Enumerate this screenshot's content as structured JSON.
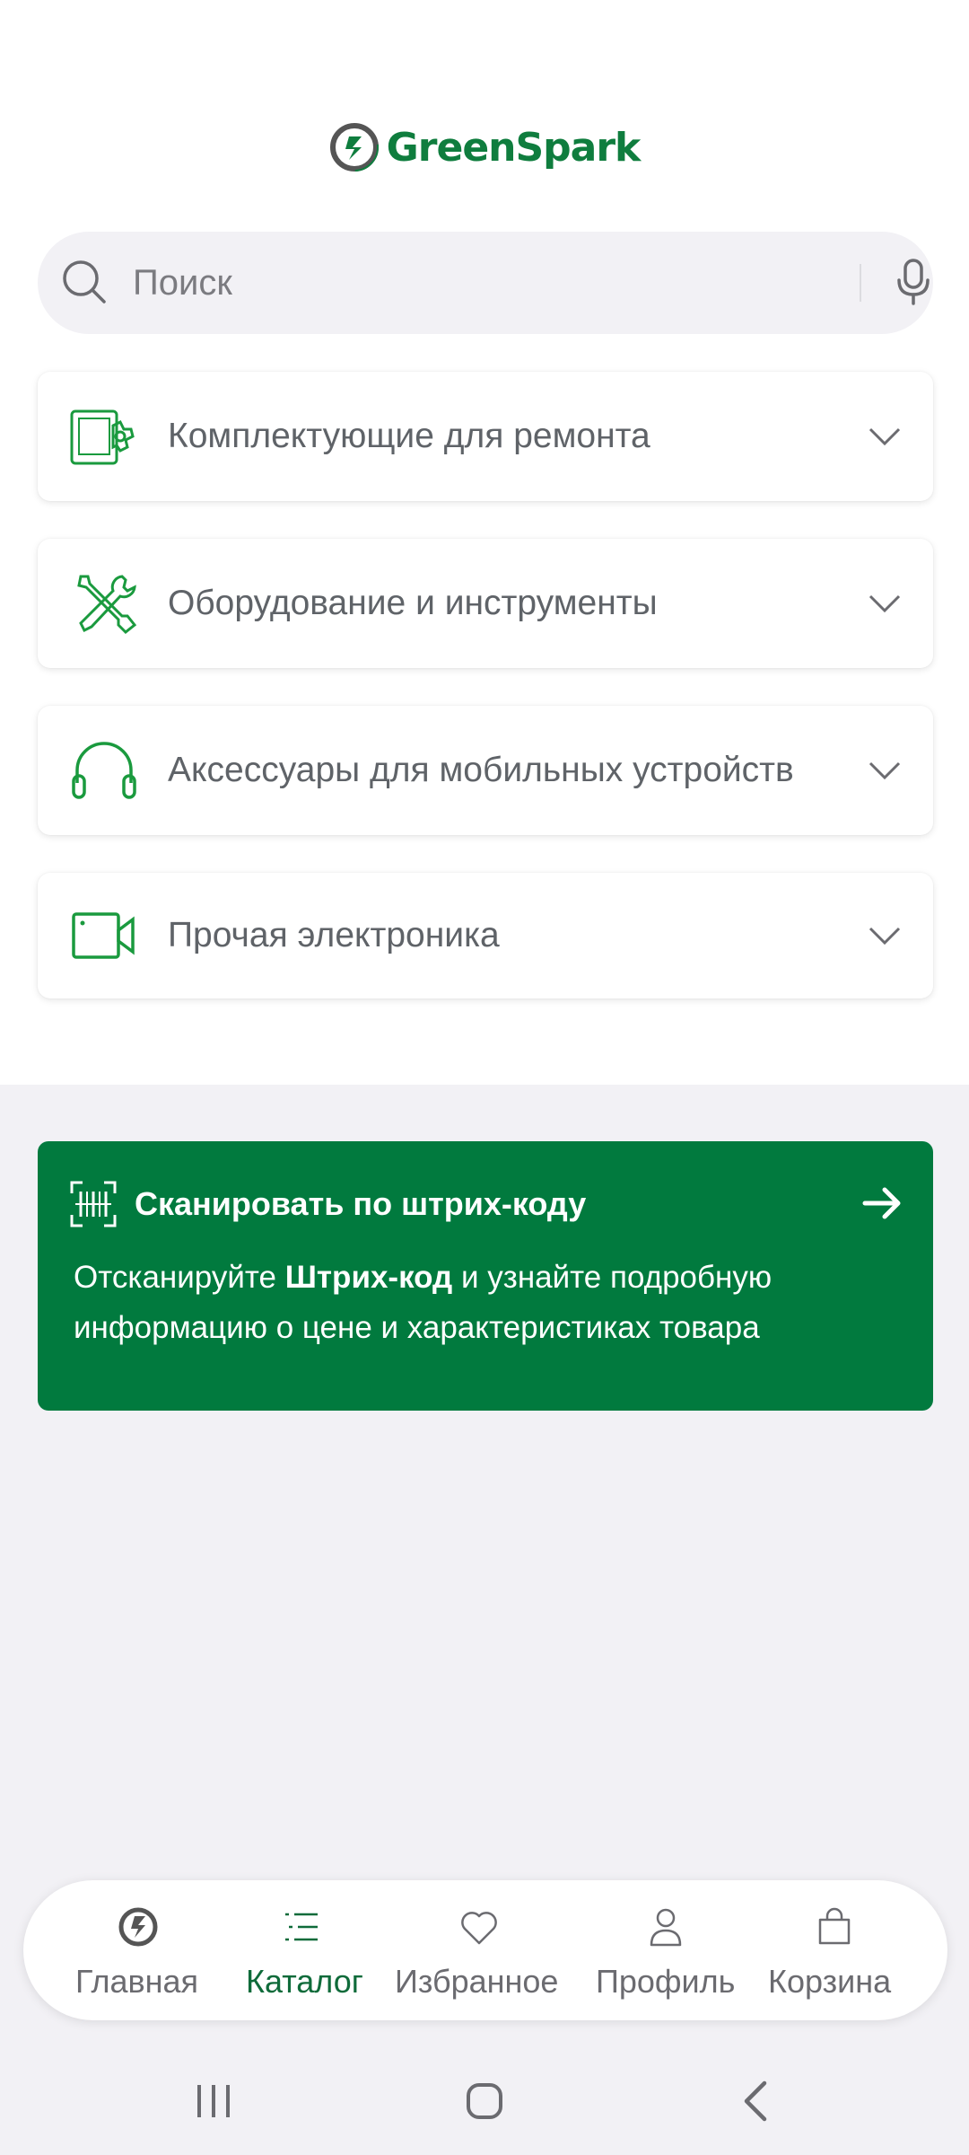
{
  "app": {
    "logo_text": "GreenSpark",
    "brand_color": "#0f7d3e",
    "accent_dark": "#017a3e"
  },
  "search": {
    "placeholder": "Поиск",
    "value": "",
    "icon": "search-icon",
    "mic_icon": "microphone-icon"
  },
  "categories": [
    {
      "label": "Комплектующие для ремонта",
      "icon": "phone-gear-icon"
    },
    {
      "label": "Оборудование и инструменты",
      "icon": "tools-icon"
    },
    {
      "label": "Аксессуары для мобильных устройств",
      "icon": "headphones-icon"
    },
    {
      "label": "Прочая электроника",
      "icon": "video-camera-icon"
    }
  ],
  "scan_banner": {
    "title": "Сканировать по штрих-коду",
    "desc_part1": "Отсканируйте ",
    "desc_bold": "Штрих-код",
    "desc_part2": " и узнайте подробную информацию о цене и характеристиках товара",
    "icon": "barcode-scan-icon",
    "arrow_icon": "arrow-right-icon"
  },
  "bottom_nav": {
    "items": [
      {
        "label": "Главная",
        "icon": "home-logo-icon",
        "active": false
      },
      {
        "label": "Каталог",
        "icon": "catalog-list-icon",
        "active": true
      },
      {
        "label": "Избранное",
        "icon": "heart-icon",
        "active": false
      },
      {
        "label": "Профиль",
        "icon": "user-icon",
        "active": false
      },
      {
        "label": "Корзина",
        "icon": "bag-icon",
        "active": false
      }
    ],
    "active_color": "#0f6b3a"
  }
}
